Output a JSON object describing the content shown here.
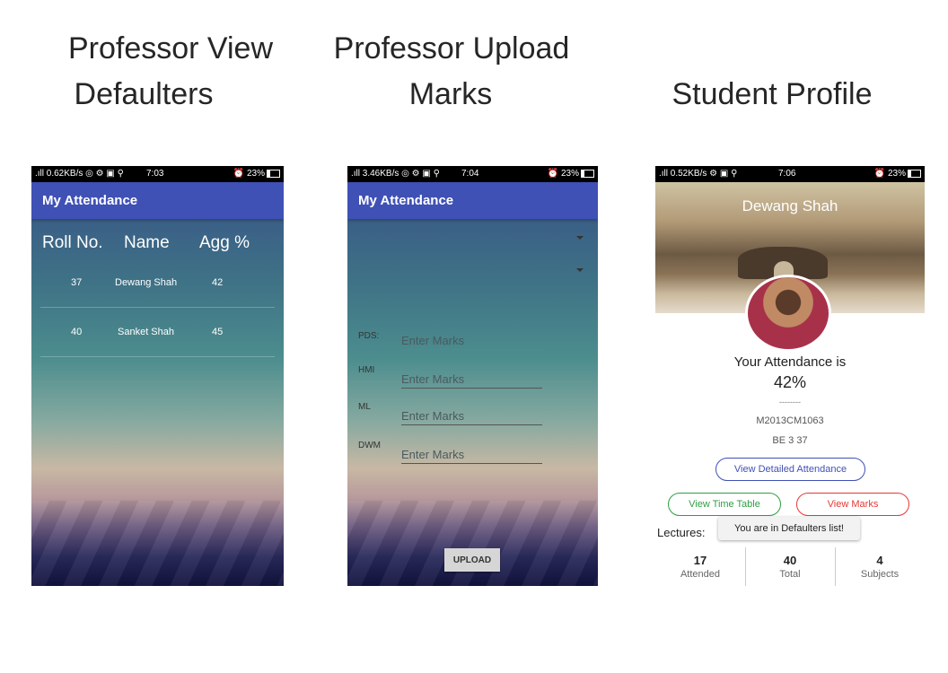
{
  "captions": {
    "defaulters_line1": "Professor View",
    "defaulters_line2": "Defaulters",
    "upload_line1": "Professor Upload",
    "upload_line2": "Marks",
    "profile": "Student Profile"
  },
  "phone1": {
    "status": {
      "left": " .ıll 0.62KB/s ◎ ⚙ ▣ ⚲",
      "time": "7:03",
      "battery": "23%"
    },
    "app_title": "My Attendance",
    "headers": [
      "Roll No.",
      "Name",
      "Agg %"
    ],
    "rows": [
      {
        "roll": "37",
        "name": "Dewang Shah",
        "agg": "42"
      },
      {
        "roll": "40",
        "name": "Sanket Shah",
        "agg": "45"
      }
    ]
  },
  "phone2": {
    "status": {
      "left": " .ıll 3.46KB/s ◎ ⚙ ▣ ⚲",
      "time": "7:04",
      "battery": "23%"
    },
    "app_title": "My Attendance",
    "fields": [
      {
        "label": "PDS:",
        "placeholder": "Enter Marks"
      },
      {
        "label": "HMI",
        "placeholder": "Enter Marks"
      },
      {
        "label": "ML",
        "placeholder": "Enter Marks"
      },
      {
        "label": "DWM",
        "placeholder": "Enter Marks"
      }
    ],
    "upload_label": "UPLOAD"
  },
  "phone3": {
    "status": {
      "left": " .ıll 0.52KB/s ⚙ ▣ ⚲",
      "time": "7:06",
      "battery": "23%"
    },
    "name": "Dewang Shah",
    "attendance_label": "Your Attendance is",
    "attendance_value": "42%",
    "dashes": "--------",
    "enrollment": "M2013CM1063",
    "class": "BE 3 37",
    "btn_detailed": "View Detailed Attendance",
    "btn_timetable": "View Time Table",
    "btn_marks": "View Marks",
    "lectures_label": "Lectures:",
    "toast": "You are in Defaulters list!",
    "stats": [
      {
        "value": "17",
        "label": "Attended"
      },
      {
        "value": "40",
        "label": "Total"
      },
      {
        "value": "4",
        "label": "Subjects"
      }
    ],
    "colors": {
      "detailed": "#3f51b5",
      "timetable": "#2e9e44",
      "marks": "#e53935"
    }
  }
}
